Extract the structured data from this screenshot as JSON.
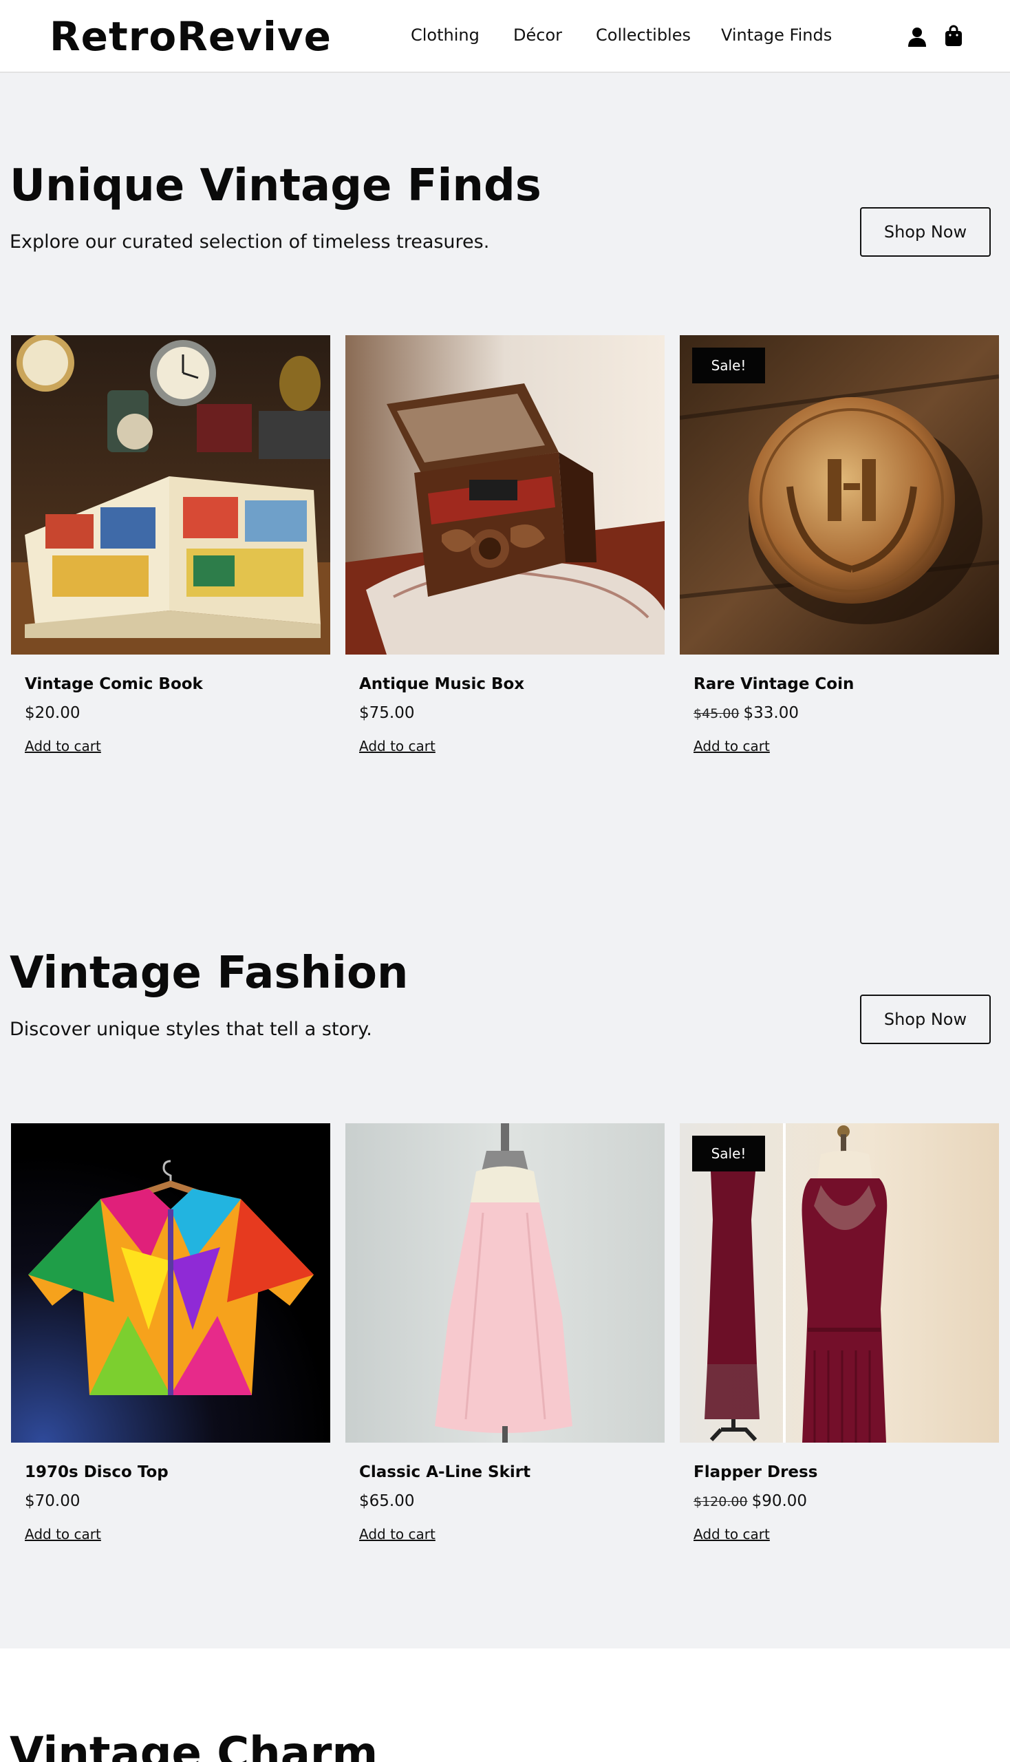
{
  "header": {
    "logo": "RetroRevive",
    "nav": [
      "Clothing",
      "Décor",
      "Collectibles",
      "Vintage Finds"
    ],
    "icons": [
      "user-icon",
      "shopping-bag-icon"
    ]
  },
  "sections": [
    {
      "title": "Unique Vintage Finds",
      "subtitle": "Explore our curated selection of timeless treasures.",
      "button": "Shop Now",
      "products": [
        {
          "name": "Vintage Comic Book",
          "price": "$20.00",
          "old_price": "",
          "sale": "",
          "cart": "Add to cart"
        },
        {
          "name": "Antique Music Box",
          "price": "$75.00",
          "old_price": "",
          "sale": "",
          "cart": "Add to cart"
        },
        {
          "name": "Rare Vintage Coin",
          "price": "$33.00",
          "old_price": "$45.00",
          "sale": "Sale!",
          "cart": "Add to cart"
        }
      ]
    },
    {
      "title": "Vintage Fashion",
      "subtitle": "Discover unique styles that tell a story.",
      "button": "Shop Now",
      "products": [
        {
          "name": "1970s Disco Top",
          "price": "$70.00",
          "old_price": "",
          "sale": "",
          "cart": "Add to cart"
        },
        {
          "name": "Classic A-Line Skirt",
          "price": "$65.00",
          "old_price": "",
          "sale": "",
          "cart": "Add to cart"
        },
        {
          "name": "Flapper Dress",
          "price": "$90.00",
          "old_price": "$120.00",
          "sale": "Sale!",
          "cart": "Add to cart"
        }
      ]
    }
  ],
  "next_section": {
    "title": "Vintage Charm"
  },
  "colors": {
    "background": "#f1f2f4",
    "text": "#111111",
    "badge": "#050505"
  }
}
